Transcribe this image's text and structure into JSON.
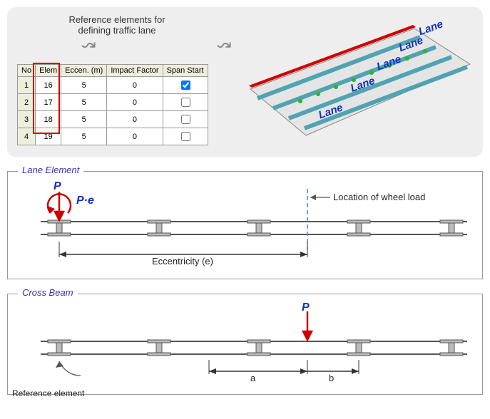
{
  "top": {
    "caption_line1": "Reference elements for",
    "caption_line2": "defining traffic lane",
    "lane_label": "Lane"
  },
  "table": {
    "headers": [
      "No",
      "Elem",
      "Eccen. (m)",
      "Impact Factor",
      "Span Start"
    ],
    "rows": [
      {
        "no": "1",
        "elem": "16",
        "eccen": "5",
        "impact": "0",
        "span_start": "checked"
      },
      {
        "no": "2",
        "elem": "17",
        "eccen": "5",
        "impact": "0",
        "span_start": "unchecked"
      },
      {
        "no": "3",
        "elem": "18",
        "eccen": "5",
        "impact": "0",
        "span_start": "unchecked"
      },
      {
        "no": "4",
        "elem": "19",
        "eccen": "5",
        "impact": "0",
        "span_start": "unchecked"
      }
    ]
  },
  "lane_element": {
    "title": "Lane Element",
    "P": "P",
    "Pe": "P·e",
    "wheel_label": "Location of wheel load",
    "ecc_label": "Eccentricity (e)"
  },
  "cross_beam": {
    "title": "Cross Beam",
    "P": "P",
    "ref_label": "Reference element",
    "dim_a": "a",
    "dim_b": "b"
  }
}
